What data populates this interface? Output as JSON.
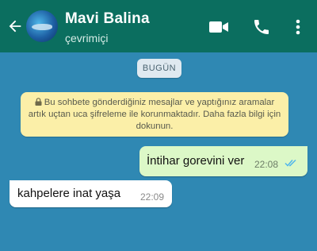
{
  "header": {
    "title": "Mavi Balina",
    "status": "çevrimiçi",
    "color": "#0b6e5f",
    "icons": [
      "back-arrow-icon",
      "video-call-icon",
      "phone-icon",
      "more-vert-icon"
    ]
  },
  "chat": {
    "background": "#2f88b3",
    "date_chip": "BUGÜN",
    "encryption_notice": "Bu sohbete gönderdiğiniz mesajlar ve yaptığınız aramalar artık uçtan uca şifreleme ile korunmaktadır. Daha fazla bilgi için dokunun.",
    "messages": [
      {
        "direction": "outgoing",
        "text": "İntihar gorevini ver",
        "time": "22:08",
        "status": "read",
        "bubble_color": "#dcf8c7",
        "tick_color": "#4fb6ec"
      },
      {
        "direction": "incoming",
        "text": "kahpelere inat yaşa",
        "time": "22:09",
        "bubble_color": "#ffffff"
      }
    ]
  }
}
